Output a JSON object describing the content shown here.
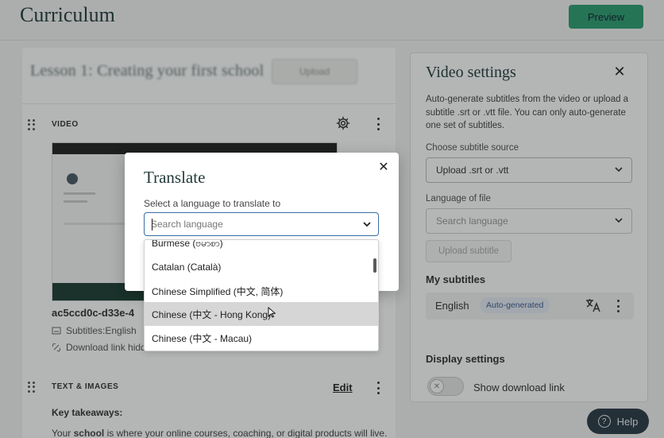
{
  "page": {
    "title": "Curriculum",
    "preview_label": "Preview"
  },
  "lesson": {
    "title": "Lesson 1: Creating your first school",
    "action_label": "Upload"
  },
  "video_section": {
    "label": "VIDEO",
    "file_name": "ac5ccd0c-d33e-4",
    "subtitles_meta": "Subtitles:English",
    "download_meta": "Download link hidde"
  },
  "text_section": {
    "label": "TEXT & IMAGES",
    "edit_label": "Edit",
    "key_takeaways": "Key takeaways:",
    "body_text_prefix": "Your ",
    "body_text_bold": "school",
    "body_text_suffix": " is where your online courses, coaching, or digital products will live."
  },
  "video_settings": {
    "title": "Video settings",
    "description": "Auto-generate subtitles from the video or upload a subtitle .srt or .vtt file. You can only auto-generate one set of subtitles.",
    "source_label": "Choose subtitle source",
    "source_value": "Upload .srt or .vtt",
    "language_label": "Language of file",
    "language_placeholder": "Search language",
    "upload_subtitle_label": "Upload subtitle",
    "my_subtitles_heading": "My subtitles",
    "subtitle_language": "English",
    "subtitle_badge": "Auto-generated",
    "display_settings_heading": "Display settings",
    "show_download_label": "Show download link"
  },
  "help": {
    "label": "Help"
  },
  "modal": {
    "title": "Translate",
    "label": "Select a language to translate to",
    "search_placeholder": "Search language",
    "options": [
      "Burmese (ဗမာစာ)",
      "Catalan (Català)",
      "Chinese Simplified (中文, 简体)",
      "Chinese (中文 - Hong Kong)",
      "Chinese (中文 - Macau)"
    ],
    "hovered_option": "Chinese (中文 - Hong Kong)"
  },
  "colors": {
    "accent_green": "#2f9e72",
    "focus_blue": "#3a6ea5",
    "badge_blue": "#3b5b8f",
    "help_bg": "#2c3a46"
  }
}
